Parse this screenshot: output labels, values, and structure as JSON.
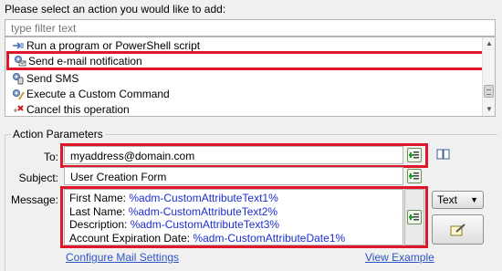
{
  "prompt": "Please select an action you would like to add:",
  "filter": {
    "placeholder": "type filter text"
  },
  "actions": [
    {
      "label": "Run a program or PowerShell script",
      "icon": "script-icon"
    },
    {
      "label": "Send e-mail notification",
      "icon": "email-gear-icon"
    },
    {
      "label": "Send SMS",
      "icon": "sms-gear-icon"
    },
    {
      "label": "Execute a Custom Command",
      "icon": "custom-command-icon"
    },
    {
      "label": "Cancel this operation",
      "icon": "cancel-x-icon"
    }
  ],
  "parameters": {
    "group_title": "Action Parameters",
    "to_label": "To:",
    "to_value": "myaddress@domain.com",
    "subject_label": "Subject:",
    "subject_value": "User Creation Form",
    "message_label": "Message:",
    "message_lines": [
      {
        "label": "First Name:",
        "tag": "%adm-CustomAttributeText1%"
      },
      {
        "label": "Last Name:",
        "tag": "%adm-CustomAttributeText2%"
      },
      {
        "label": "Description:",
        "tag": "%adm-CustomAttributeText3%"
      },
      {
        "label": "Account Expiration Date:",
        "tag": "%adm-CustomAttributeDate1%"
      }
    ],
    "format_select": "Text",
    "configure_link": "Configure Mail Settings",
    "view_example_link": "View Example"
  },
  "colors": {
    "highlight": "#e0162b",
    "link": "#2d55c7",
    "tag": "#1b2fcf"
  }
}
